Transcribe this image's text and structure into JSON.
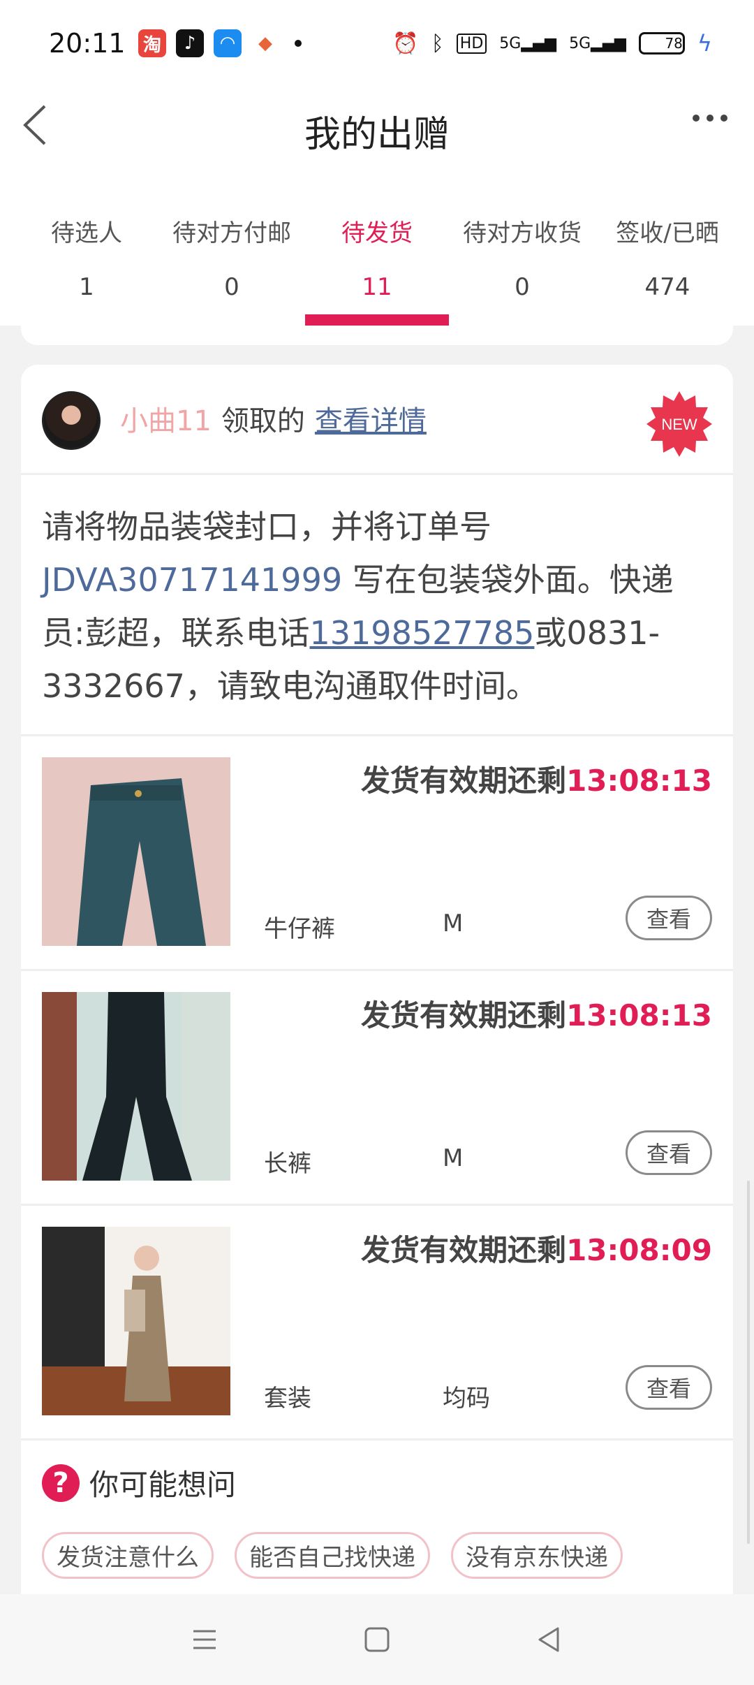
{
  "status_bar": {
    "time": "20:11",
    "battery": "78",
    "network_labels": [
      "HD",
      "5G",
      "5G"
    ]
  },
  "header": {
    "title": "我的出赠"
  },
  "tabs": [
    {
      "label": "待选人",
      "count": "1"
    },
    {
      "label": "待对方付邮",
      "count": "0"
    },
    {
      "label": "待发货",
      "count": "11"
    },
    {
      "label": "待对方收货",
      "count": "0"
    },
    {
      "label": "签收/已晒",
      "count": "474"
    }
  ],
  "card": {
    "user": "小曲11",
    "action": "领取的",
    "detail_link": "查看详情",
    "badge": "NEW",
    "notice": {
      "part1": "请将物品装袋封口，并将订单号 ",
      "order_no": "JDVA30717141999",
      "part2": " 写在包装袋外面。快递员:彭超，联系电话",
      "phone": "13198527785",
      "part3": "或0831-3332667，请致电沟通取件时间。"
    },
    "items": [
      {
        "deadline_label": "发货有效期还剩",
        "deadline_time": "13:08:13",
        "name": "牛仔裤",
        "size": "M",
        "view": "查看"
      },
      {
        "deadline_label": "发货有效期还剩",
        "deadline_time": "13:08:13",
        "name": "长裤",
        "size": "M",
        "view": "查看"
      },
      {
        "deadline_label": "发货有效期还剩",
        "deadline_time": "13:08:09",
        "name": "套装",
        "size": "均码",
        "view": "查看"
      }
    ]
  },
  "faq": {
    "title": "你可能想问",
    "chips": [
      "发货注意什么",
      "能否自己找快递",
      "没有京东快递"
    ]
  },
  "colors": {
    "accent": "#e11d55",
    "link": "#4e6a9a",
    "username": "#f0a6a6"
  }
}
